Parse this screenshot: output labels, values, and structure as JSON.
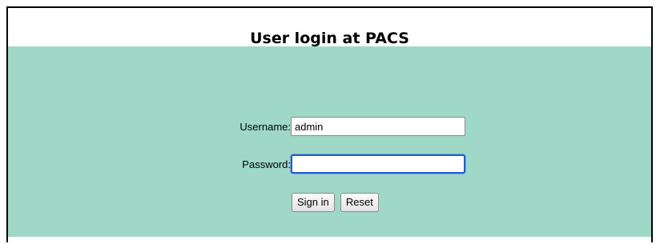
{
  "page": {
    "title": "User login at PACS"
  },
  "form": {
    "username_label": "Username:",
    "username_value": "admin",
    "password_label": "Password:",
    "password_value": "",
    "signin_label": "Sign in",
    "reset_label": "Reset"
  },
  "colors": {
    "panel_background": "#9fd8c6",
    "focus_ring": "#1f5fc7"
  }
}
